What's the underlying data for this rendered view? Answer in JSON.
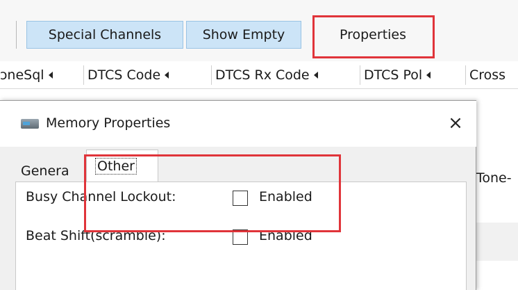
{
  "toolbar": {
    "special_channels_label": "Special Channels",
    "show_empty_label": "Show Empty",
    "properties_label": "Properties"
  },
  "columns": [
    {
      "label": "ɔneSql"
    },
    {
      "label": "DTCS Code"
    },
    {
      "label": "DTCS Rx Code"
    },
    {
      "label": "DTCS Pol"
    },
    {
      "label": "Cross"
    }
  ],
  "background": {
    "partial_label": "Tone-"
  },
  "dialog": {
    "title": "Memory Properties",
    "close_glyph": "×",
    "tabs": [
      {
        "label": "Genera"
      },
      {
        "label": "Other"
      }
    ],
    "rows": [
      {
        "label": "Busy Channel Lockout:",
        "checkbox_label": "Enabled",
        "checked": false
      },
      {
        "label": "Beat Shift(scramble):",
        "checkbox_label": "Enabled",
        "checked": false
      }
    ]
  },
  "colors": {
    "highlight_red": "#e0343a",
    "toolbar_button_blue": "#cce4f7"
  }
}
